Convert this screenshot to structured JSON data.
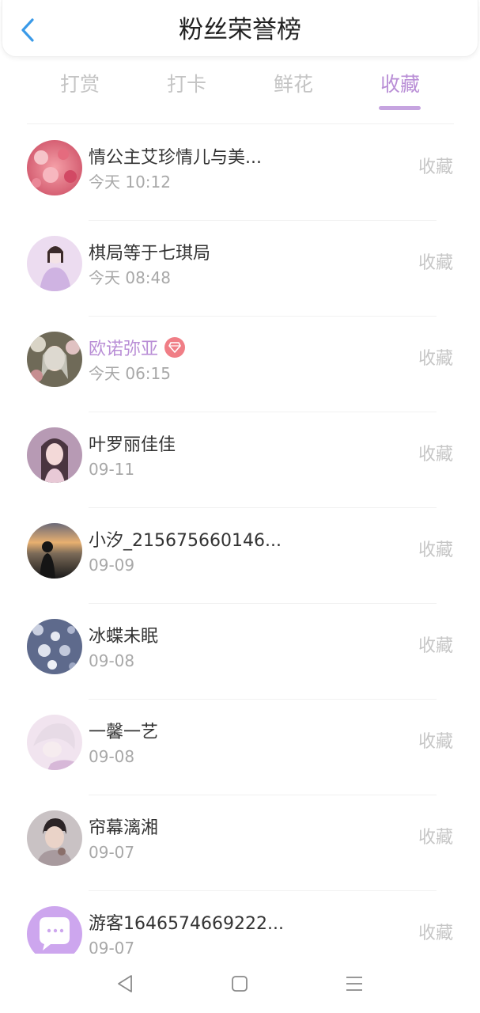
{
  "header": {
    "title": "粉丝荣誉榜",
    "back_icon": "chevron-left-icon",
    "accent_color": "#3a9ae8"
  },
  "tabs": [
    {
      "label": "打赏",
      "active": false
    },
    {
      "label": "打卡",
      "active": false
    },
    {
      "label": "鲜花",
      "active": false
    },
    {
      "label": "收藏",
      "active": true
    }
  ],
  "theme": {
    "active_color": "#b98ed6",
    "inactive_color": "#c4c4c4",
    "vip_badge_color": "#f07e86"
  },
  "fans": [
    {
      "name": "情公主艾珍情儿与美...",
      "time": "今天 10:12",
      "action": "收藏",
      "vip": false
    },
    {
      "name": "棋局等于七琪局",
      "time": "今天 08:48",
      "action": "收藏",
      "vip": false
    },
    {
      "name": "欧诺弥亚",
      "time": "今天 06:15",
      "action": "收藏",
      "vip": true,
      "badge_icon": "diamond-icon"
    },
    {
      "name": "叶罗丽佳佳",
      "time": "09-11",
      "action": "收藏",
      "vip": false
    },
    {
      "name": "小汐_215675660146...",
      "time": "09-09",
      "action": "收藏",
      "vip": false
    },
    {
      "name": "冰蝶未眠",
      "time": "09-08",
      "action": "收藏",
      "vip": false
    },
    {
      "name": "一馨一艺",
      "time": "09-08",
      "action": "收藏",
      "vip": false
    },
    {
      "name": "帘幕漓湘",
      "time": "09-07",
      "action": "收藏",
      "vip": false
    },
    {
      "name": "游客1646574669222...",
      "time": "09-07",
      "action": "收藏",
      "vip": false
    }
  ],
  "navbar": {
    "back_icon": "triangle-back-icon",
    "home_icon": "square-home-icon",
    "menu_icon": "hamburger-menu-icon"
  }
}
